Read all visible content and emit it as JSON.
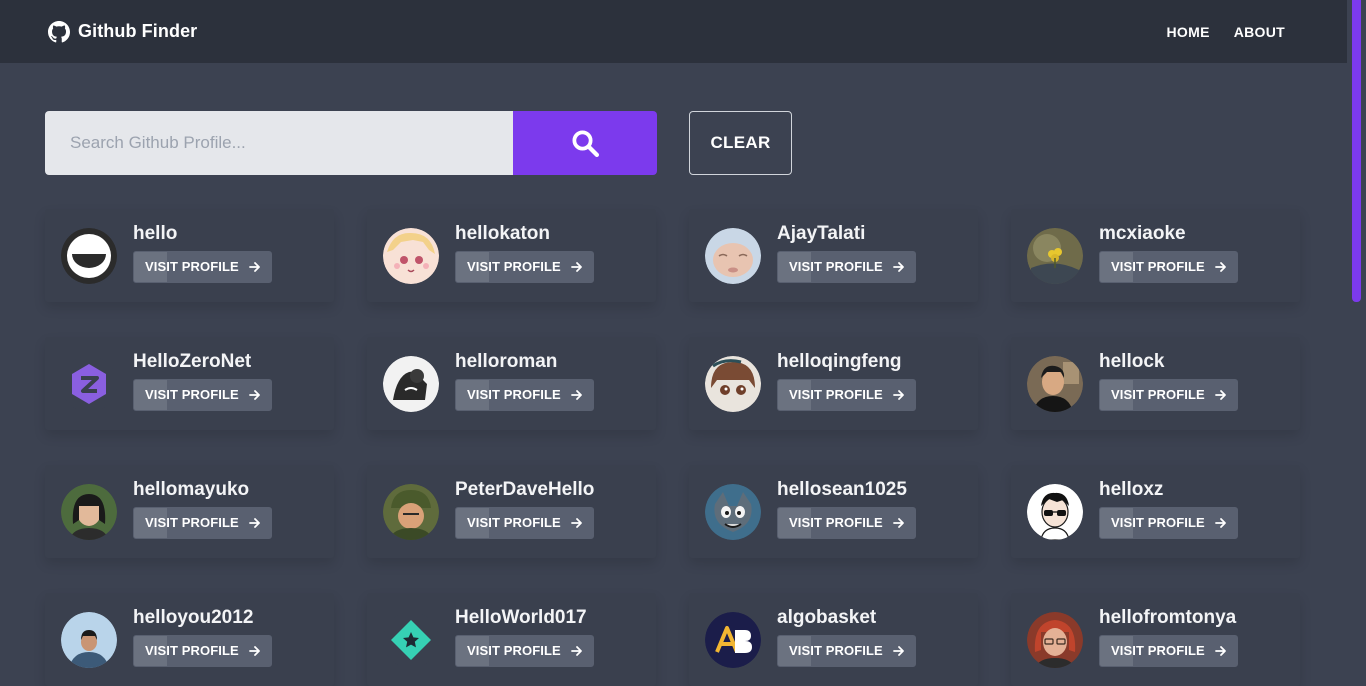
{
  "app": {
    "title": "Github Finder",
    "nav": [
      {
        "label": "HOME"
      },
      {
        "label": "ABOUT"
      }
    ]
  },
  "search": {
    "placeholder": "Search Github Profile...",
    "value": "",
    "clear_label": "CLEAR"
  },
  "colors": {
    "accent": "#7c3aed",
    "navbar": "#2c313c",
    "background": "#3c4251"
  },
  "visit_label": "VISIT PROFILE",
  "users": [
    {
      "login": "hello"
    },
    {
      "login": "hellokaton"
    },
    {
      "login": "AjayTalati"
    },
    {
      "login": "mcxiaoke"
    },
    {
      "login": "HelloZeroNet"
    },
    {
      "login": "helloroman"
    },
    {
      "login": "helloqingfeng"
    },
    {
      "login": "hellock"
    },
    {
      "login": "hellomayuko"
    },
    {
      "login": "PeterDaveHello"
    },
    {
      "login": "hellosean1025"
    },
    {
      "login": "helloxz"
    },
    {
      "login": "helloyou2012"
    },
    {
      "login": "HelloWorld017"
    },
    {
      "login": "algobasket"
    },
    {
      "login": "hellofromtonya"
    }
  ]
}
